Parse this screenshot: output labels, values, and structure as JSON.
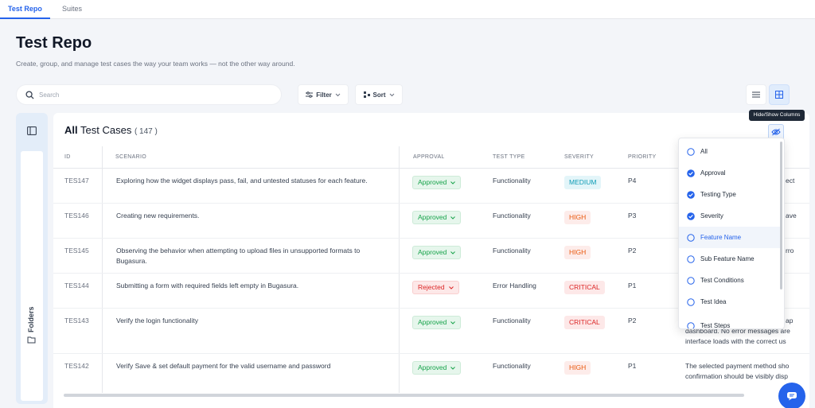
{
  "tabs": [
    {
      "label": "Test Repo"
    },
    {
      "label": "Suites"
    }
  ],
  "page": {
    "title": "Test Repo",
    "subtitle": "Create, group, and manage test cases the way your team works — not the other way around."
  },
  "toolbar": {
    "search_placeholder": "Search",
    "filter_label": "Filter",
    "sort_label": "Sort"
  },
  "sidebar": {
    "folders_label": "Folders"
  },
  "panel": {
    "title_bold": "All",
    "title_rest": "Test Cases",
    "count": "( 147 )"
  },
  "tooltip": "Hide/Show Columns",
  "table": {
    "columns": [
      "ID",
      "SCENARIO",
      "APPROVAL",
      "TEST TYPE",
      "SEVERITY",
      "PRIORITY"
    ],
    "rows": [
      {
        "id": "TES147",
        "scenario": "Exploring how the widget displays pass, fail, and untested statuses for each feature.",
        "approval": "Approved",
        "type": "Functionality",
        "severity": "MEDIUM",
        "priority": "P4",
        "extra": [
          "ect"
        ]
      },
      {
        "id": "TES146",
        "scenario": "Creating new requirements.",
        "approval": "Approved",
        "type": "Functionality",
        "severity": "HIGH",
        "priority": "P3",
        "extra": [
          "ave"
        ]
      },
      {
        "id": "TES145",
        "scenario": "Observing the behavior when attempting to upload files in unsupported formats to Bugasura.",
        "approval": "Approved",
        "type": "Functionality",
        "severity": "HIGH",
        "priority": "P2",
        "extra": [
          "rro"
        ]
      },
      {
        "id": "TES144",
        "scenario": "Submitting a form with required fields left empty in Bugasura.",
        "approval": "Rejected",
        "type": "Error Handling",
        "severity": "CRITICAL",
        "priority": "P1",
        "extra": []
      },
      {
        "id": "TES143",
        "scenario": "Verify the login functionality",
        "approval": "Approved",
        "type": "Functionality",
        "severity": "CRITICAL",
        "priority": "P2",
        "extra": [
          "ap",
          "dashboard. No error messages are",
          "interface loads with the correct us"
        ]
      },
      {
        "id": "TES142",
        "scenario": "Verify Save & set default payment for the valid username and password",
        "approval": "Approved",
        "type": "Functionality",
        "severity": "HIGH",
        "priority": "P1",
        "extra": [
          "The selected payment method sho",
          "confirmation should be visibly disp"
        ]
      }
    ]
  },
  "columns_menu": [
    {
      "label": "All",
      "checked": false
    },
    {
      "label": "Approval",
      "checked": true
    },
    {
      "label": "Testing Type",
      "checked": true
    },
    {
      "label": "Severity",
      "checked": true
    },
    {
      "label": "Feature Name",
      "checked": false
    },
    {
      "label": "Sub Feature Name",
      "checked": false
    },
    {
      "label": "Test Conditions",
      "checked": false
    },
    {
      "label": "Test Idea",
      "checked": false
    },
    {
      "label": "Test Steps",
      "checked": false
    }
  ],
  "colors": {
    "accent": "#2563eb",
    "approved": "#16a34a",
    "rejected": "#dc2626"
  }
}
